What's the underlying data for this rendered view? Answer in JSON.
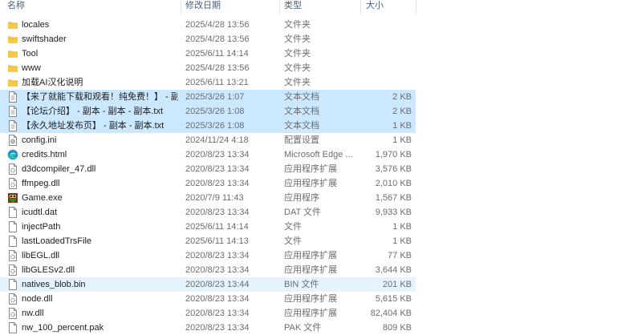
{
  "columns": {
    "name": "名称",
    "date": "修改日期",
    "type": "类型",
    "size": "大小"
  },
  "files": [
    {
      "name": "locales",
      "date": "2025/4/28 13:56",
      "type": "文件夹",
      "size": "",
      "icon": "folder-icon",
      "state": ""
    },
    {
      "name": "swiftshader",
      "date": "2025/4/28 13:56",
      "type": "文件夹",
      "size": "",
      "icon": "folder-icon",
      "state": ""
    },
    {
      "name": "Tool",
      "date": "2025/6/11 14:14",
      "type": "文件夹",
      "size": "",
      "icon": "folder-icon",
      "state": ""
    },
    {
      "name": "www",
      "date": "2025/4/28 13:56",
      "type": "文件夹",
      "size": "",
      "icon": "folder-icon",
      "state": ""
    },
    {
      "name": "加载AI汉化说明",
      "date": "2025/6/11 13:21",
      "type": "文件夹",
      "size": "",
      "icon": "folder-icon",
      "state": ""
    },
    {
      "name": "【来了就能下载和观看！纯免费！】 - 副...",
      "date": "2025/3/26 1:07",
      "type": "文本文档",
      "size": "2 KB",
      "icon": "text-file-icon",
      "state": "selected"
    },
    {
      "name": "【论坛介绍】 - 副本 - 副本 - 副本.txt",
      "date": "2025/3/26 1:08",
      "type": "文本文档",
      "size": "2 KB",
      "icon": "text-file-icon",
      "state": "selected"
    },
    {
      "name": "【永久地址发布页】 - 副本 - 副本.txt",
      "date": "2025/3/26 1:08",
      "type": "文本文档",
      "size": "1 KB",
      "icon": "text-file-icon",
      "state": "selected"
    },
    {
      "name": "config.ini",
      "date": "2024/11/24 4:18",
      "type": "配置设置",
      "size": "1 KB",
      "icon": "config-file-icon",
      "state": ""
    },
    {
      "name": "credits.html",
      "date": "2020/8/23 13:34",
      "type": "Microsoft Edge ...",
      "size": "1,970 KB",
      "icon": "edge-icon",
      "state": ""
    },
    {
      "name": "d3dcompiler_47.dll",
      "date": "2020/8/23 13:34",
      "type": "应用程序扩展",
      "size": "3,576 KB",
      "icon": "dll-file-icon",
      "state": ""
    },
    {
      "name": "ffmpeg.dll",
      "date": "2020/8/23 13:34",
      "type": "应用程序扩展",
      "size": "2,010 KB",
      "icon": "dll-file-icon",
      "state": ""
    },
    {
      "name": "Game.exe",
      "date": "2020/7/9 11:43",
      "type": "应用程序",
      "size": "1,567 KB",
      "icon": "game-exe-icon",
      "state": ""
    },
    {
      "name": "icudtl.dat",
      "date": "2020/8/23 13:34",
      "type": "DAT 文件",
      "size": "9,933 KB",
      "icon": "blank-file-icon",
      "state": ""
    },
    {
      "name": "injectPath",
      "date": "2025/6/11 14:14",
      "type": "文件",
      "size": "1 KB",
      "icon": "blank-file-icon",
      "state": ""
    },
    {
      "name": "lastLoadedTrsFile",
      "date": "2025/6/11 14:13",
      "type": "文件",
      "size": "1 KB",
      "icon": "blank-file-icon",
      "state": ""
    },
    {
      "name": "libEGL.dll",
      "date": "2020/8/23 13:34",
      "type": "应用程序扩展",
      "size": "77 KB",
      "icon": "dll-file-icon",
      "state": ""
    },
    {
      "name": "libGLESv2.dll",
      "date": "2020/8/23 13:34",
      "type": "应用程序扩展",
      "size": "3,644 KB",
      "icon": "dll-file-icon",
      "state": ""
    },
    {
      "name": "natives_blob.bin",
      "date": "2020/8/23 13:44",
      "type": "BIN 文件",
      "size": "201 KB",
      "icon": "blank-file-icon",
      "state": "hover"
    },
    {
      "name": "node.dll",
      "date": "2020/8/23 13:34",
      "type": "应用程序扩展",
      "size": "5,615 KB",
      "icon": "dll-file-icon",
      "state": ""
    },
    {
      "name": "nw.dll",
      "date": "2020/8/23 13:34",
      "type": "应用程序扩展",
      "size": "82,404 KB",
      "icon": "dll-file-icon",
      "state": ""
    },
    {
      "name": "nw_100_percent.pak",
      "date": "2020/8/23 13:34",
      "type": "PAK 文件",
      "size": "809 KB",
      "icon": "blank-file-icon",
      "state": ""
    }
  ]
}
